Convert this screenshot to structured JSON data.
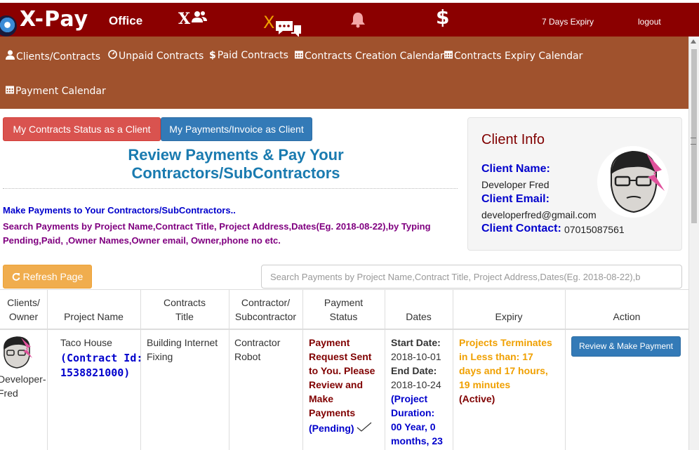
{
  "topbar": {
    "brand": "X-Pay",
    "office": "Office",
    "users_x": "X",
    "chat_x": "X",
    "dollar": "$",
    "expiry": "7 Days Expiry",
    "logout": "logout"
  },
  "nav": {
    "items": [
      {
        "label": "Clients/Contracts",
        "icon": "user-icon"
      },
      {
        "label": "Unpaid Contracts",
        "icon": "dashboard-icon"
      },
      {
        "label": "Paid Contracts",
        "icon": "dollar-icon"
      },
      {
        "label": "Contracts Creation Calendar",
        "icon": "calendar-icon"
      },
      {
        "label": "Contracts Expiry Calendar",
        "icon": "calendar-icon"
      },
      {
        "label": "Payment Calendar",
        "icon": "calendar-icon"
      }
    ]
  },
  "tabs": {
    "contracts_status": "My Contracts Status as a Client",
    "payments_invoice": "My Payments/Invoice as Client"
  },
  "main": {
    "title_line1": "Review Payments & Pay Your",
    "title_line2": "Contractors/SubContractors",
    "desc1": "Make Payments to Your Contractors/SubContractors..",
    "desc2": "Search Payments by Project Name,Contract Title, Project Address,Dates(Eg. 2018-08-22),by Typing Pending,Paid, ,Owner Names,Owner email, Owner,phone no etc.",
    "refresh_label": "Refresh Page",
    "search_placeholder": "Search Payments by Project Name,Contract Title, Project Address,Dates(Eg. 2018-08-22),b"
  },
  "client_info": {
    "title": "Client Info",
    "name_label": "Client Name:",
    "name_value": "Developer Fred",
    "email_label": "Client Email:",
    "email_value": "developerfred@gmail.com",
    "contact_label": "Client Contact:",
    "contact_value": "07015087561"
  },
  "table": {
    "headers": {
      "owner": [
        "Clients/",
        "Owner"
      ],
      "project": "Project Name",
      "title": [
        "Contracts",
        "Title"
      ],
      "contractor": [
        "Contractor/",
        "Subcontractor"
      ],
      "status": [
        "Payment",
        "Status"
      ],
      "dates": "Dates",
      "expiry": "Expiry",
      "action": "Action"
    },
    "row": {
      "owner_name": [
        "Developer-",
        "Fred"
      ],
      "project_name": "Taco House",
      "contract_id": [
        "(Contract Id:",
        "1538821000)"
      ],
      "contract_title": [
        "Building Internet",
        "Fixing"
      ],
      "contractor": [
        "Contractor",
        "Robot"
      ],
      "status_lines": [
        "Payment",
        "Request Sent",
        "to You. Please",
        "Review and",
        "Make",
        "Payments"
      ],
      "status_badge": "(Pending)",
      "start_label": "Start Date:",
      "start_date": "2018-10-01",
      "end_label": "End Date:",
      "end_date": "2018-10-24",
      "duration_lines": [
        "(Project",
        "Duration:",
        "00 Year, 0",
        "months, 23"
      ],
      "expiry_lines": [
        "Projects Terminates",
        "in Less than: 17",
        "days and 17 hours,",
        "19 minutes"
      ],
      "expiry_state": "(Active)",
      "action_label": "Review & Make Payment"
    }
  },
  "colors": {
    "topbar": "#8b0000",
    "navbar": "#a0522d",
    "title_blue": "#1a7bb0",
    "orange": "#f0a000"
  }
}
